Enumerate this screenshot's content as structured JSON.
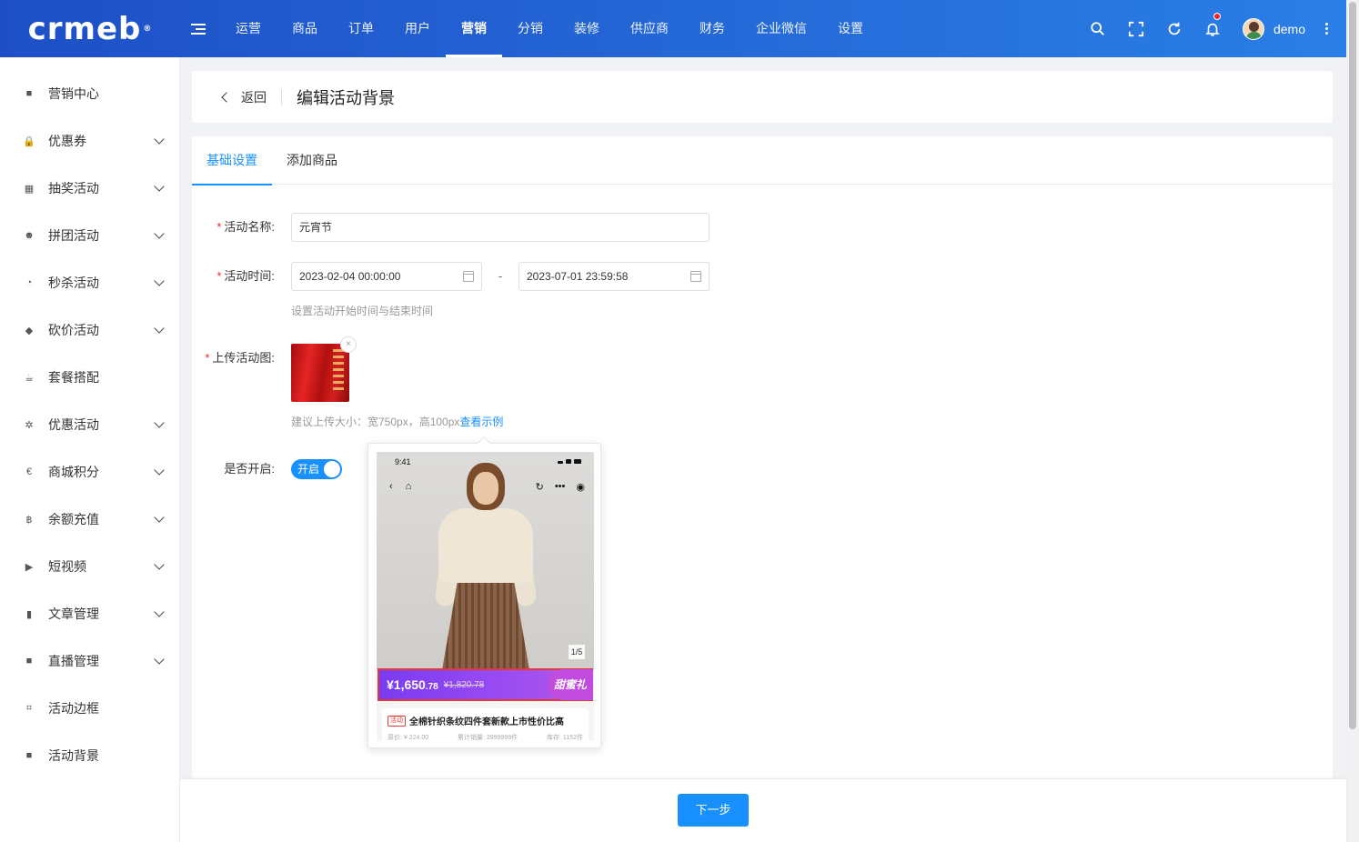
{
  "header": {
    "logo": "crmeb",
    "logo_mark": "®",
    "nav": [
      "运营",
      "商品",
      "订单",
      "用户",
      "营销",
      "分销",
      "装修",
      "供应商",
      "财务",
      "企业微信",
      "设置"
    ],
    "active_nav": "营销",
    "username": "demo",
    "icons": [
      "search-icon",
      "fullscreen-icon",
      "refresh-icon",
      "bell-icon",
      "more-icon"
    ],
    "accent": "#1e4fc7"
  },
  "sidebar": {
    "items": [
      {
        "label": "营销中心",
        "icon": "square-icon",
        "expandable": false
      },
      {
        "label": "优惠券",
        "icon": "lock-icon",
        "expandable": true
      },
      {
        "label": "抽奖活动",
        "icon": "grid-icon",
        "expandable": true
      },
      {
        "label": "拼团活动",
        "icon": "group-icon",
        "expandable": true
      },
      {
        "label": "秒杀活动",
        "icon": "clock-icon",
        "expandable": true
      },
      {
        "label": "砍价活动",
        "icon": "tag-icon",
        "expandable": true
      },
      {
        "label": "套餐搭配",
        "icon": "cup-icon",
        "expandable": false
      },
      {
        "label": "优惠活动",
        "icon": "gift-icon",
        "expandable": true
      },
      {
        "label": "商城积分",
        "icon": "euro-icon",
        "expandable": true
      },
      {
        "label": "余额充值",
        "icon": "baht-icon",
        "expandable": true
      },
      {
        "label": "短视频",
        "icon": "video-icon",
        "expandable": true
      },
      {
        "label": "文章管理",
        "icon": "book-icon",
        "expandable": true
      },
      {
        "label": "直播管理",
        "icon": "camera-icon",
        "expandable": true
      },
      {
        "label": "活动边框",
        "icon": "crop-icon",
        "expandable": false
      },
      {
        "label": "活动背景",
        "icon": "square-icon",
        "expandable": false
      }
    ]
  },
  "page": {
    "back_label": "返回",
    "title": "编辑活动背景"
  },
  "tabs": [
    "基础设置",
    "添加商品"
  ],
  "active_tab": "基础设置",
  "form": {
    "name_label": "活动名称:",
    "name_value": "元宵节",
    "time_label": "活动时间:",
    "start_time": "2023-02-04 00:00:00",
    "end_time": "2023-07-01 23:59:58",
    "range_sep": "-",
    "time_hint": "设置活动开始时间与结束时间",
    "upload_label": "上传活动图:",
    "upload_hint": "建议上传大小：宽750px，高100px",
    "example_link": "查看示例",
    "switch_label": "是否开启:",
    "switch_text": "开启",
    "switch_on": true,
    "required_mark": "*"
  },
  "example": {
    "status_time": "9:41",
    "page_indicator": "1/5",
    "price_main": "¥1,650",
    "price_decimal": ".78",
    "price_orig": "¥1,820.78",
    "tag": "甜蜜礼",
    "product_tag": "活动",
    "product_title": "全棉针织条纹四件套新款上市性价比高",
    "product_sub_1": "原价: ¥ 224.00",
    "product_sub_2": "累计销量: 2999999件",
    "product_sub_3": "库存: 1152件"
  },
  "footer": {
    "next_label": "下一步"
  }
}
